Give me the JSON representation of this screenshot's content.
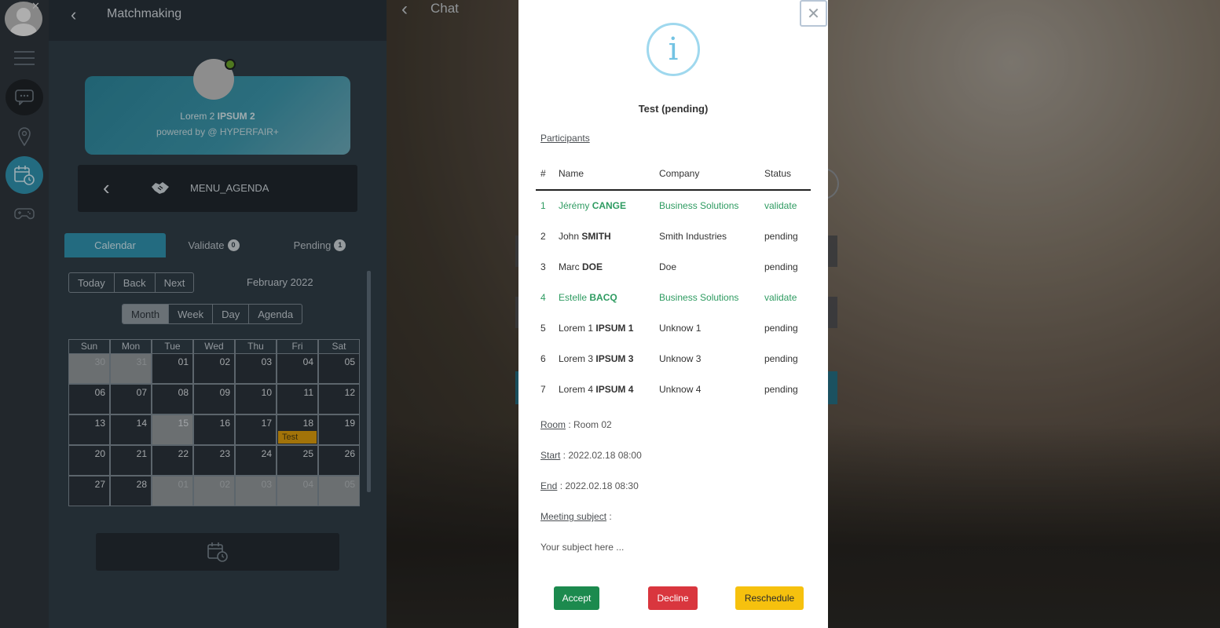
{
  "chat": {
    "title": "Chat"
  },
  "matchmaking": {
    "title": "Matchmaking",
    "profile": {
      "name_prefix": "Lorem 2",
      "name_bold": "IPSUM 2",
      "powered": "powered by @ HYPERFAIR+"
    },
    "menu_label": "MENU_AGENDA",
    "tabs": [
      {
        "label": "Calendar"
      },
      {
        "label": "Validate",
        "badge": "0"
      },
      {
        "label": "Pending",
        "badge": "1"
      }
    ],
    "nav_buttons": [
      "Today",
      "Back",
      "Next"
    ],
    "month_label": "February 2022",
    "views": [
      "Month",
      "Week",
      "Day",
      "Agenda"
    ],
    "weekdays": [
      "Sun",
      "Mon",
      "Tue",
      "Wed",
      "Thu",
      "Fri",
      "Sat"
    ],
    "weeks": [
      [
        "30",
        "31",
        "01",
        "02",
        "03",
        "04",
        "05"
      ],
      [
        "06",
        "07",
        "08",
        "09",
        "10",
        "11",
        "12"
      ],
      [
        "13",
        "14",
        "15",
        "16",
        "17",
        "18",
        "19"
      ],
      [
        "20",
        "21",
        "22",
        "23",
        "24",
        "25",
        "26"
      ],
      [
        "27",
        "28",
        "01",
        "02",
        "03",
        "04",
        "05"
      ]
    ],
    "event_label": "Test"
  },
  "modal": {
    "title": "Test (pending)",
    "participants_label": "Participants",
    "columns": [
      "#",
      "Name",
      "Company",
      "Status"
    ],
    "participants": [
      {
        "num": "1",
        "first": "Jérémy",
        "last": "CANGE",
        "company": "Business Solutions",
        "status": "validate"
      },
      {
        "num": "2",
        "first": "John",
        "last": "SMITH",
        "company": "Smith Industries",
        "status": "pending"
      },
      {
        "num": "3",
        "first": "Marc",
        "last": "DOE",
        "company": "Doe",
        "status": "pending"
      },
      {
        "num": "4",
        "first": "Estelle",
        "last": "BACQ",
        "company": "Business Solutions",
        "status": "validate"
      },
      {
        "num": "5",
        "first": "Lorem 1",
        "last": "IPSUM 1",
        "company": "Unknow 1",
        "status": "pending"
      },
      {
        "num": "6",
        "first": "Lorem 3",
        "last": "IPSUM 3",
        "company": "Unknow 3",
        "status": "pending"
      },
      {
        "num": "7",
        "first": "Lorem 4",
        "last": "IPSUM 4",
        "company": "Unknow 4",
        "status": "pending"
      }
    ],
    "room_label": "Room",
    "room_value": " : Room 02",
    "start_label": "Start",
    "start_value": " : 2022.02.18 08:00",
    "end_label": "End",
    "end_value": " : 2022.02.18 08:30",
    "subject_label": "Meeting subject",
    "subject_sep": " :",
    "subject_value": "Your subject here ...",
    "accept": "Accept",
    "decline": "Decline",
    "reschedule": "Reschedule"
  },
  "colors": {
    "accent": "#2f8fab",
    "validate": "#2e9b61",
    "accept": "#1c8a4e",
    "decline": "#d9363e",
    "reschedule": "#f6c10e",
    "event": "#d99a0c"
  }
}
